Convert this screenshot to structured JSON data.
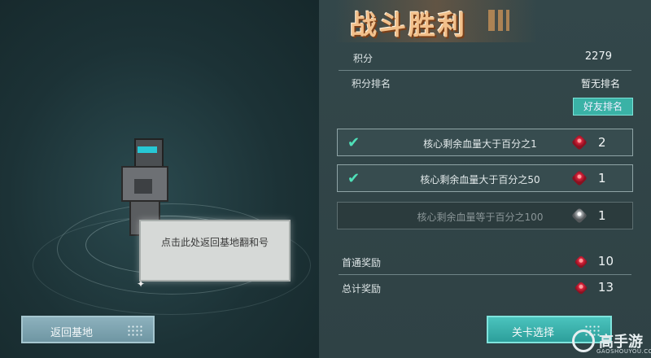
{
  "title": "战斗胜利",
  "score": {
    "label": "积分",
    "value": "2279"
  },
  "rank": {
    "label": "积分排名",
    "value": "暂无排名",
    "friend_button": "好友排名"
  },
  "tasks": [
    {
      "label": "核心剩余血量大于百分之1",
      "reward": "2",
      "completed": true,
      "gem": "red-gem-icon"
    },
    {
      "label": "核心剩余血量大于百分之50",
      "reward": "1",
      "completed": true,
      "gem": "red-gem-icon"
    },
    {
      "label": "核心剩余血量等于百分之100",
      "reward": "1",
      "completed": false,
      "gem": "grey-gem-icon"
    }
  ],
  "first_reward": {
    "label": "首通奖励",
    "value": "10"
  },
  "total_reward": {
    "label": "总计奖励",
    "value": "13"
  },
  "tooltip": {
    "text": "点击此处返回基地翻和号"
  },
  "buttons": {
    "back_base": "返回基地",
    "level_select": "关卡选择"
  },
  "watermark": {
    "text": "高手游",
    "sub": "GAOSHOUYOU.COM"
  }
}
